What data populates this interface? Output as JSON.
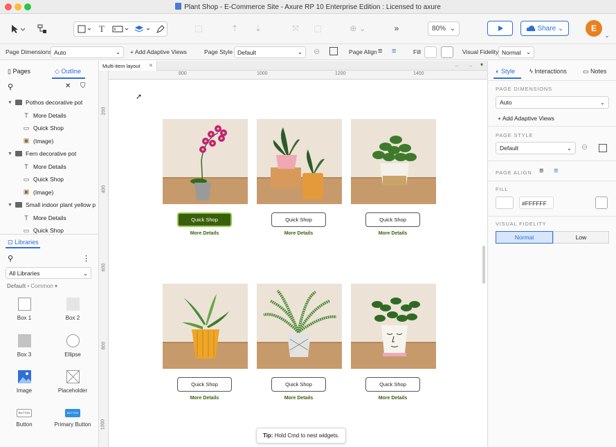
{
  "window": {
    "title": "Plant Shop - E-Commerce Site - Axure RP 10 Enterprise Edition : Licensed to axure"
  },
  "toolbar": {
    "zoom": "80%",
    "share_label": "Share",
    "avatar_initial": "E"
  },
  "propbar": {
    "page_dimensions_label": "Page Dimensions",
    "page_dimensions_value": "Auto",
    "add_adaptive_views": "+ Add Adaptive Views",
    "page_style_label": "Page Style",
    "page_style_value": "Default",
    "page_align_label": "Page Align",
    "fill_label": "Fill",
    "visual_fidelity_label": "Visual Fidelity",
    "visual_fidelity_value": "Normal"
  },
  "left_panel": {
    "tabs": {
      "pages": "Pages",
      "outline": "Outline"
    },
    "outline": [
      {
        "type": "folder",
        "label": "Pothos decorative pot"
      },
      {
        "type": "text",
        "label": "More Details"
      },
      {
        "type": "button",
        "label": "Quick Shop"
      },
      {
        "type": "image",
        "label": "(Image)"
      },
      {
        "type": "folder",
        "label": "Fern decorative pot"
      },
      {
        "type": "text",
        "label": "More Details"
      },
      {
        "type": "button",
        "label": "Quick Shop"
      },
      {
        "type": "image",
        "label": "(Image)"
      },
      {
        "type": "folder",
        "label": "Small indoor plant yellow p"
      },
      {
        "type": "text",
        "label": "More Details"
      },
      {
        "type": "button",
        "label": "Quick Shop"
      }
    ],
    "libraries_label": "Libraries",
    "library_select": "All Libraries",
    "library_group": "Default",
    "library_subgroup": "Common",
    "widgets": [
      "Box 1",
      "Box 2",
      "Box 3",
      "Ellipse",
      "Image",
      "Placeholder",
      "Button",
      "Primary Button"
    ],
    "widget_button_text": "BUTTON"
  },
  "canvas": {
    "tab_label": "Multi-item layout",
    "ruler_top": [
      "800",
      "1000",
      "1200",
      "1400"
    ],
    "ruler_left": [
      "200",
      "400",
      "600",
      "800",
      "1000"
    ],
    "products": [
      {
        "button": "Quick Shop",
        "link": "More Details",
        "selected": true,
        "plant": "orchid"
      },
      {
        "button": "Quick Shop",
        "link": "More Details",
        "selected": false,
        "plant": "snake"
      },
      {
        "button": "Quick Shop",
        "link": "More Details",
        "selected": false,
        "plant": "pothos"
      },
      {
        "button": "Quick Shop",
        "link": "More Details",
        "selected": false,
        "plant": "yellow"
      },
      {
        "button": "Quick Shop",
        "link": "More Details",
        "selected": false,
        "plant": "fern"
      },
      {
        "button": "Quick Shop",
        "link": "More Details",
        "selected": false,
        "plant": "face"
      }
    ],
    "tip_bold": "Tip:",
    "tip_text": "Hold Cmd to nest widgets."
  },
  "right_panel": {
    "tabs": {
      "style": "Style",
      "interactions": "Interactions",
      "notes": "Notes"
    },
    "page_dimensions_head": "PAGE DIMENSIONS",
    "page_dimensions_value": "Auto",
    "add_adaptive_views": "+ Add Adaptive Views",
    "page_style_head": "PAGE STYLE",
    "page_style_value": "Default",
    "page_align_head": "PAGE ALIGN",
    "fill_head": "FILL",
    "fill_value": "#FFFFFF",
    "visual_fidelity_head": "VISUAL FIDELITY",
    "fidelity_normal": "Normal",
    "fidelity_low": "Low"
  },
  "colors": {
    "accent": "#2f6fd6",
    "brand_green": "#3a5f0b",
    "avatar": "#e8811f"
  }
}
